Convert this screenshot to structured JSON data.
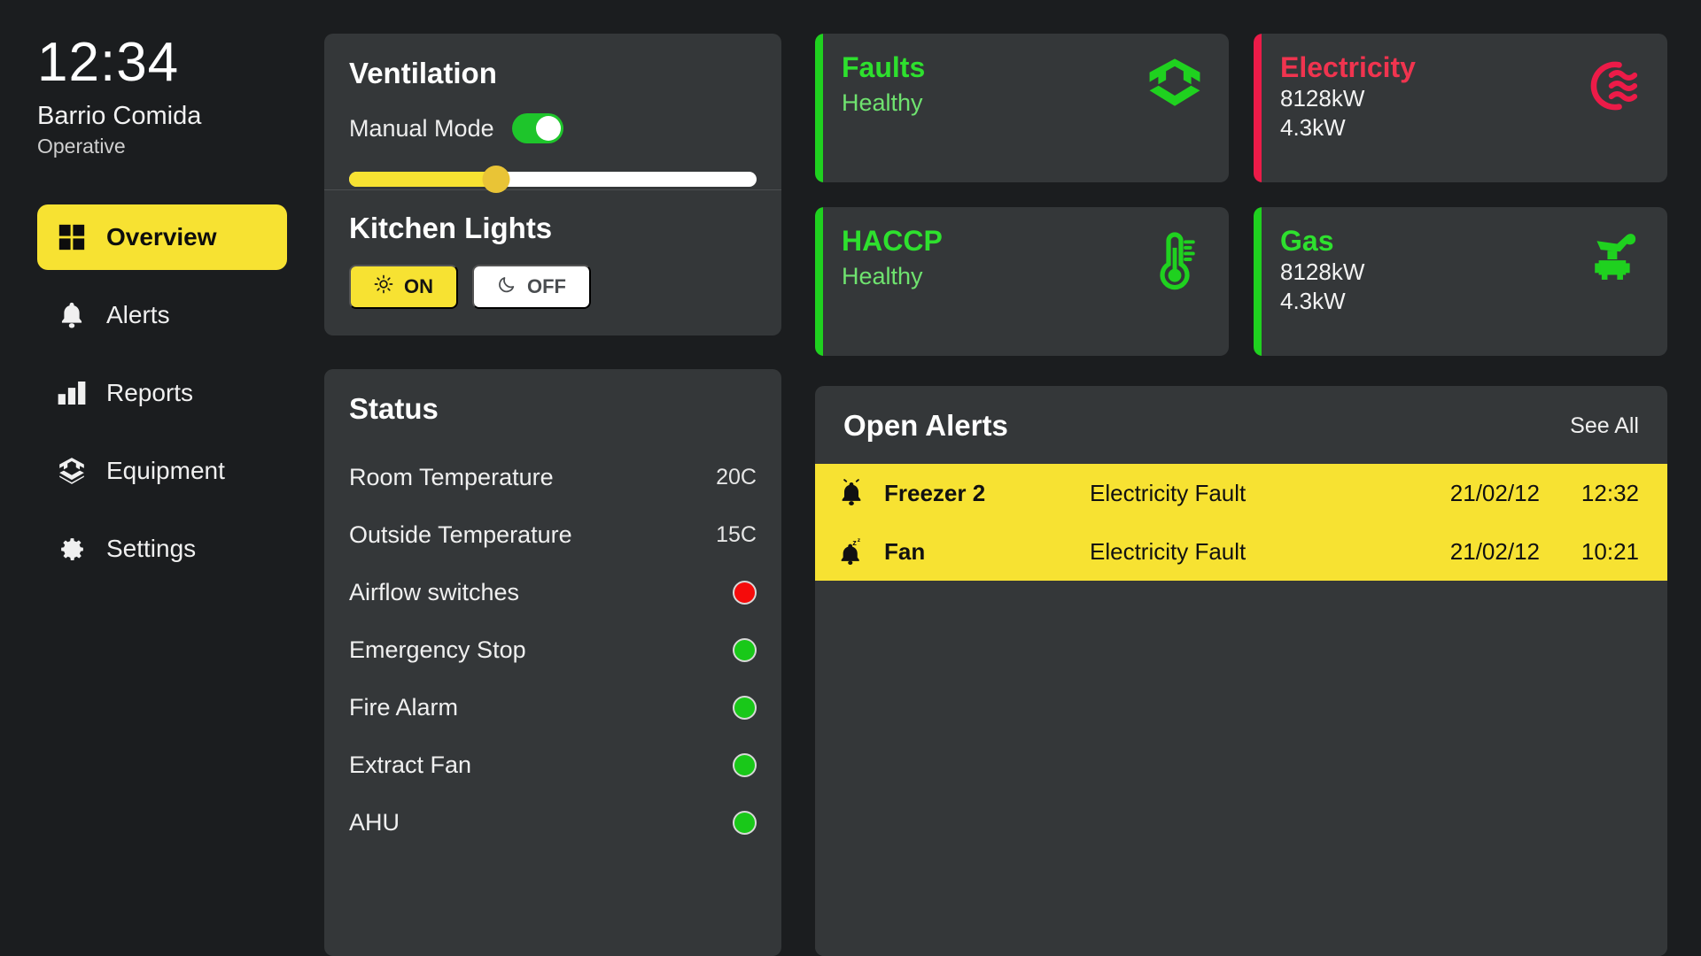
{
  "header": {
    "time": "12:34",
    "site_name": "Barrio Comida",
    "site_state": "Operative"
  },
  "sidebar": {
    "items": [
      {
        "label": "Overview",
        "icon": "grid-icon",
        "active": true
      },
      {
        "label": "Alerts",
        "icon": "bell-icon",
        "active": false
      },
      {
        "label": "Reports",
        "icon": "bar-chart-icon",
        "active": false
      },
      {
        "label": "Equipment",
        "icon": "hexagon-icon",
        "active": false
      },
      {
        "label": "Settings",
        "icon": "gear-icon",
        "active": false
      }
    ]
  },
  "ventilation": {
    "title": "Ventilation",
    "manual_mode_label": "Manual Mode",
    "manual_mode_on": true,
    "slider_percent": 36
  },
  "kitchen_lights": {
    "title": "Kitchen Lights",
    "on_label": "ON",
    "off_label": "OFF",
    "selected": "ON"
  },
  "status": {
    "title": "Status",
    "rows": [
      {
        "label": "Room Temperature",
        "type": "value",
        "value": "20C"
      },
      {
        "label": "Outside Temperature",
        "type": "value",
        "value": "15C"
      },
      {
        "label": "Airflow switches",
        "type": "dot",
        "value": "red"
      },
      {
        "label": "Emergency Stop",
        "type": "dot",
        "value": "green"
      },
      {
        "label": "Fire Alarm",
        "type": "dot",
        "value": "green"
      },
      {
        "label": "Extract Fan",
        "type": "dot",
        "value": "green"
      },
      {
        "label": "AHU",
        "type": "dot",
        "value": "green"
      }
    ]
  },
  "tiles": [
    {
      "title": "Faults",
      "subtitle": "Healthy",
      "values": [],
      "icon": "hexagon-icon",
      "accent": "#1fd11f",
      "title_color": "#2ee02e",
      "sub_color": "#6fe36f"
    },
    {
      "title": "Electricity",
      "subtitle": "",
      "values": [
        "8128kW",
        "4.3kW"
      ],
      "icon": "electricity-wave-icon",
      "accent": "#ec1b48",
      "title_color": "#f0344f",
      "sub_color": "#f0f0f0"
    },
    {
      "title": "HACCP",
      "subtitle": "Healthy",
      "values": [],
      "icon": "thermometer-icon",
      "accent": "#1fd11f",
      "title_color": "#2ee02e",
      "sub_color": "#6fe36f"
    },
    {
      "title": "Gas",
      "subtitle": "",
      "values": [
        "8128kW",
        "4.3kW"
      ],
      "icon": "gas-valve-icon",
      "accent": "#1fd11f",
      "title_color": "#2ee02e",
      "sub_color": "#f0f0f0"
    }
  ],
  "alerts": {
    "title": "Open Alerts",
    "see_all_label": "See All",
    "rows": [
      {
        "icon": "bell-ringing-icon",
        "name": "Freezer 2",
        "type": "Electricity Fault",
        "date": "21/02/12",
        "time": "12:32"
      },
      {
        "icon": "bell-snooze-icon",
        "name": "Fan",
        "type": "Electricity Fault",
        "date": "21/02/12",
        "time": "10:21"
      }
    ]
  },
  "colors": {
    "accent_yellow": "#f7e232",
    "page_bg": "#1b1d1f",
    "card_bg": "#343739",
    "green": "#1fd11f",
    "red": "#ec1b48"
  }
}
